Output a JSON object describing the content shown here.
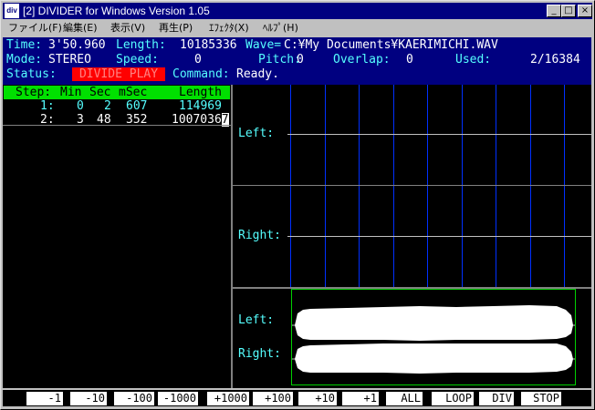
{
  "window": {
    "app_icon": "div",
    "title": "[2] DIVIDER for Windows Version 1.05",
    "minimize": "_",
    "maximize": "□",
    "close": "×"
  },
  "menu": [
    "ファイル(F)",
    "編集(E)",
    "表示(V)",
    "再生(P)",
    "ｴﾌｪｸﾀ(X)",
    "ﾍﾙﾌﾟ(H)"
  ],
  "info": {
    "time_label": "Time:",
    "time_value": "3'50.960",
    "length_label": "Length:",
    "length_value": "10185336",
    "wave_label": "Wave=",
    "wave_value": "C:¥My Documents¥KAERIMICHI.WAV",
    "mode_label": "Mode:",
    "mode_value": "STEREO",
    "speed_label": "Speed:",
    "speed_value": "0",
    "pitch_label": "Pitch:",
    "pitch_value": "0",
    "overlap_label": "Overlap:",
    "overlap_value": "0",
    "used_label": "Used:",
    "used_value": "2/16384",
    "status_label": "Status:",
    "status_value": "DIVIDE PLAY",
    "command_label": "Command:",
    "command_value": "Ready."
  },
  "list": {
    "headers": {
      "step": "Step:",
      "min": "Min",
      "sec": "Sec",
      "msec": "mSec",
      "length": "Length"
    },
    "rows": [
      {
        "step": "1:",
        "min": "0",
        "sec": "2",
        "msec": "607",
        "length": "114969"
      },
      {
        "step": "2:",
        "min": "3",
        "sec": "48",
        "msec": "352",
        "length_main": "1007036",
        "length_cursor": "7"
      }
    ]
  },
  "channels": {
    "left": "Left:",
    "right": "Right:"
  },
  "buttons": [
    "-1",
    "-10",
    "-100",
    "-1000",
    "+1000",
    "+100",
    "+10",
    "+1",
    "ALL",
    "LOOP",
    "DIV",
    "STOP"
  ],
  "colors": {
    "titlebar": "#000080",
    "info_bg": "#000080",
    "info_text": "#55ffff",
    "status_badge": "#ff0000",
    "list_header": "#00e000",
    "grid_line": "#0030ff",
    "wave_border": "#00d000"
  }
}
